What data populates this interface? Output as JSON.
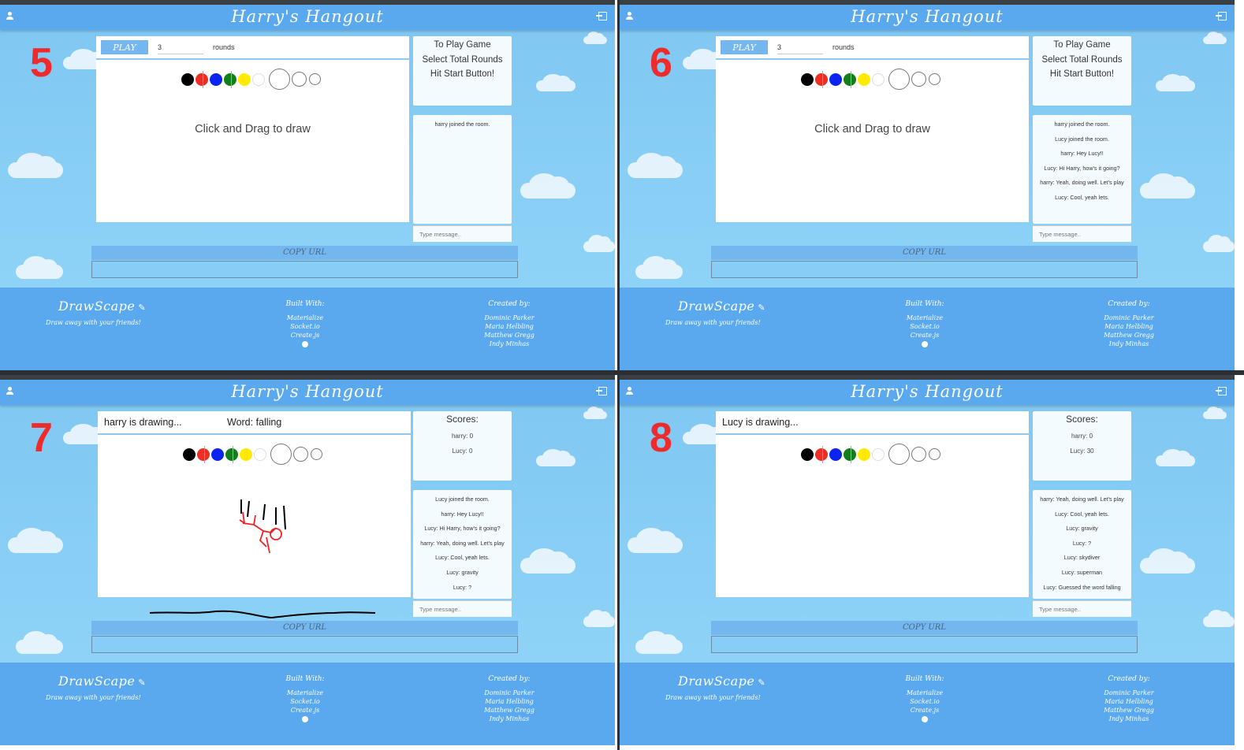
{
  "app": {
    "title": "Harry's Hangout",
    "brand": "DrawScape",
    "tagline": "Draw away with your friends!",
    "built_with_heading": "Built With:",
    "built_with": [
      "Materialize",
      "Socket.io",
      "Create.js"
    ],
    "created_by_heading": "Created by:",
    "created_by": [
      "Dominic Parker",
      "Maria Helbling",
      "Matthew Gregg",
      "Indy Minhas"
    ],
    "copy_url_label": "COPY URL",
    "chat_placeholder": "Type message..",
    "colors": {
      "navbar": "#5aa9ef",
      "sky": "#87cdf5",
      "step_number": "#ee2a2a",
      "palette": [
        "#000000",
        "#ee2e24",
        "#0b24f2",
        "#11801c",
        "#ffea00",
        "#ffffff"
      ]
    }
  },
  "panels": [
    {
      "step": "5",
      "play_label": "PLAY",
      "rounds_value": "3",
      "rounds_label": "rounds",
      "canvas_hint": "Click and Drag to draw",
      "instructions": [
        "To Play Game",
        "Select Total Rounds",
        "Hit Start Button!"
      ],
      "chat": [
        "harry joined the room."
      ]
    },
    {
      "step": "6",
      "play_label": "PLAY",
      "rounds_value": "3",
      "rounds_label": "rounds",
      "canvas_hint": "Click and Drag to draw",
      "instructions": [
        "To Play Game",
        "Select Total Rounds",
        "Hit Start Button!"
      ],
      "chat": [
        "harry joined the room.",
        "Lucy joined the room.",
        "harry: Hey Lucy!!",
        "Lucy: Hi Harry, how's it going?",
        "harry: Yeah, doing well. Let's play",
        "Lucy: Cool, yeah lets."
      ]
    },
    {
      "step": "7",
      "drawing_status": "harry is drawing...",
      "word": "Word: falling",
      "scores_title": "Scores:",
      "scores": [
        "harry: 0",
        "Lucy: 0"
      ],
      "chat": [
        "Lucy joined the room.",
        "harry: Hey Lucy!!",
        "Lucy: Hi Harry, how's it going?",
        "harry: Yeah, doing well. Let's play",
        "Lucy: Cool, yeah lets.",
        "Lucy: gravity",
        "Lucy: ?"
      ]
    },
    {
      "step": "8",
      "drawing_status": "Lucy is drawing...",
      "scores_title": "Scores:",
      "scores": [
        "harry: 0",
        "Lucy: 30"
      ],
      "chat": [
        "harry: Yeah, doing well. Let's play",
        "Lucy: Cool, yeah lets.",
        "Lucy: gravity",
        "Lucy: ?",
        "Lucy: skydiver",
        "Lucy: superman",
        "Lucy: Guessed the word falling"
      ]
    }
  ]
}
